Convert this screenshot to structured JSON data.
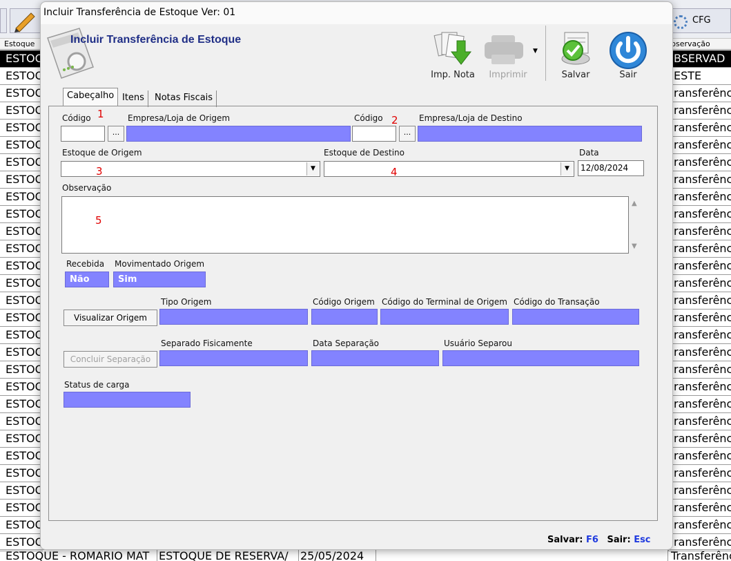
{
  "background": {
    "toolbar_right": "CFG",
    "header_left": "Estoque",
    "header_right": "bservação",
    "left_rows": [
      "ESTOQ",
      "ESTOQ",
      "ESTOQ",
      "ESTOQ",
      "ESTOQ",
      "ESTOQ",
      "ESTOQ",
      "ESTOQ",
      "ESTOQ",
      "ESTOQ",
      "ESTOQ",
      "ESTOQ",
      "ESTOQ",
      "ESTOQ",
      "ESTOQ",
      "ESTOQ",
      "ESTOQ",
      "ESTOQ",
      "ESTOQ",
      "ESTOQ",
      "ESTOQ",
      "ESTOQ",
      "ESTOQ",
      "ESTOQ",
      "ESTOQ",
      "ESTOQ",
      "ESTOQ",
      "ESTOQ",
      "ESTOQ"
    ],
    "right_rows": [
      "BSERVAD",
      "ESTE",
      "ransferênci",
      "ransferênci",
      "ransferênci",
      "ransferênci",
      "ransferênci",
      "ransferênci",
      "ransferênci",
      "ransferênci",
      "ransferênci",
      "ransferênci",
      "ransferênci",
      "ransferênci",
      "ransferênci",
      "ransferênci",
      "ransferênci",
      "ransferênci",
      "ransferênci",
      "ransferênci",
      "ransferênci",
      "ransferênci",
      "ransferênci",
      "ransferênci",
      "ransferênci",
      "ransferênci",
      "ransferênci",
      "ransferênci",
      "ransferênci"
    ],
    "bottom_row": {
      "c1": "ESTOQUE - ROMARIO MAT",
      "c2": "ESTOQUE DE RESERVA/",
      "c3": "25/05/2024",
      "c4": "Transferênci"
    }
  },
  "dialog": {
    "title": "Incluir Transferência de Estoque Ver: 01",
    "heading": "Incluir Transferência de Estoque",
    "toolbar": {
      "imp_nota": "Imp. Nota",
      "imprimir": "Imprimir",
      "salvar": "Salvar",
      "sair": "Sair"
    },
    "tabs": [
      "Cabeçalho",
      "Itens",
      "Notas Fiscais"
    ],
    "form": {
      "codigo_label": "Código",
      "empresa_origem_label": "Empresa/Loja de Origem",
      "codigo2_label": "Código",
      "empresa_destino_label": "Empresa/Loja de Destino",
      "estoque_origem_label": "Estoque de Origem",
      "estoque_destino_label": "Estoque de Destino",
      "data_label": "Data",
      "data_value": "12/08/2024",
      "observacao_label": "Observação",
      "recebida_label": "Recebida",
      "recebida_value": "Não",
      "mov_origem_label": "Movimentado Origem",
      "mov_origem_value": "Sim",
      "visualizar_origem": "Visualizar Origem",
      "tipo_origem_label": "Tipo Origem",
      "codigo_origem_label": "Código Origem",
      "codigo_terminal_label": "Código do Terminal de Origem",
      "codigo_transacao_label": "Código do Transação",
      "concluir_separacao": "Concluir Separação",
      "separado_label": "Separado Fisicamente",
      "data_separacao_label": "Data Separação",
      "usuario_separou_label": "Usuário Separou",
      "status_carga_label": "Status de carga",
      "dots": "...",
      "annotations": [
        "1",
        "2",
        "3",
        "4",
        "5"
      ]
    },
    "footer": {
      "salvar_label": "Salvar:",
      "salvar_key": "F6",
      "sair_label": "Sair:",
      "sair_key": "Esc"
    },
    "colors": {
      "accent_field": "#8383ff",
      "heading": "#1f2e86",
      "annotation": "#e00000"
    }
  }
}
